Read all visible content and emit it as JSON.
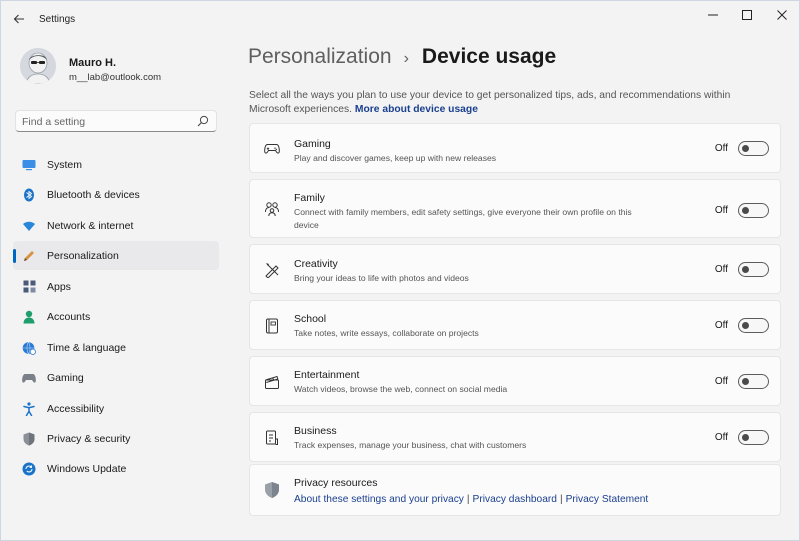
{
  "window": {
    "title": "Settings"
  },
  "profile": {
    "name": "Mauro H.",
    "email": "m__lab@outlook.com"
  },
  "search": {
    "placeholder": "Find a setting"
  },
  "sidebar": {
    "items": [
      {
        "label": "System",
        "icon": "system-icon",
        "color": "#2b7bd4"
      },
      {
        "label": "Bluetooth & devices",
        "icon": "bluetooth-icon",
        "color": "#1a73c9"
      },
      {
        "label": "Network & internet",
        "icon": "wifi-icon",
        "color": "#2a86d8"
      },
      {
        "label": "Personalization",
        "icon": "pencil-icon",
        "color": "#c97b2a",
        "active": true
      },
      {
        "label": "Apps",
        "icon": "apps-icon",
        "color": "#4a5a78"
      },
      {
        "label": "Accounts",
        "icon": "person-icon",
        "color": "#1e9e6a"
      },
      {
        "label": "Time & language",
        "icon": "globe-clock-icon",
        "color": "#2b7bd4"
      },
      {
        "label": "Gaming",
        "icon": "gamepad-icon",
        "color": "#6b7280"
      },
      {
        "label": "Accessibility",
        "icon": "accessibility-icon",
        "color": "#1a73c9"
      },
      {
        "label": "Privacy & security",
        "icon": "shield-icon",
        "color": "#7a7f88"
      },
      {
        "label": "Windows Update",
        "icon": "update-icon",
        "color": "#1a73c9"
      }
    ]
  },
  "header": {
    "parent": "Personalization",
    "separator": "›",
    "current": "Device usage"
  },
  "intro": {
    "text": "Select all the ways you plan to use your device to get personalized tips, ads, and recommendations within Microsoft experiences.",
    "link": "More about device usage"
  },
  "usages": [
    {
      "title": "Gaming",
      "description": "Play and discover games, keep up with new releases",
      "state": "Off",
      "icon": "gamepad-icon"
    },
    {
      "title": "Family",
      "description": "Connect with family members, edit safety settings, give everyone their own profile on this device",
      "state": "Off",
      "icon": "family-icon"
    },
    {
      "title": "Creativity",
      "description": "Bring your ideas to life with photos and videos",
      "state": "Off",
      "icon": "creativity-icon"
    },
    {
      "title": "School",
      "description": "Take notes, write essays, collaborate on projects",
      "state": "Off",
      "icon": "school-icon"
    },
    {
      "title": "Entertainment",
      "description": "Watch videos, browse the web, connect on social media",
      "state": "Off",
      "icon": "clapperboard-icon"
    },
    {
      "title": "Business",
      "description": "Track expenses, manage your business, chat with customers",
      "state": "Off",
      "icon": "business-icon"
    }
  ],
  "privacy": {
    "title": "Privacy resources",
    "links": [
      "About these settings and your privacy",
      "Privacy dashboard",
      "Privacy Statement"
    ],
    "separator": "|"
  }
}
